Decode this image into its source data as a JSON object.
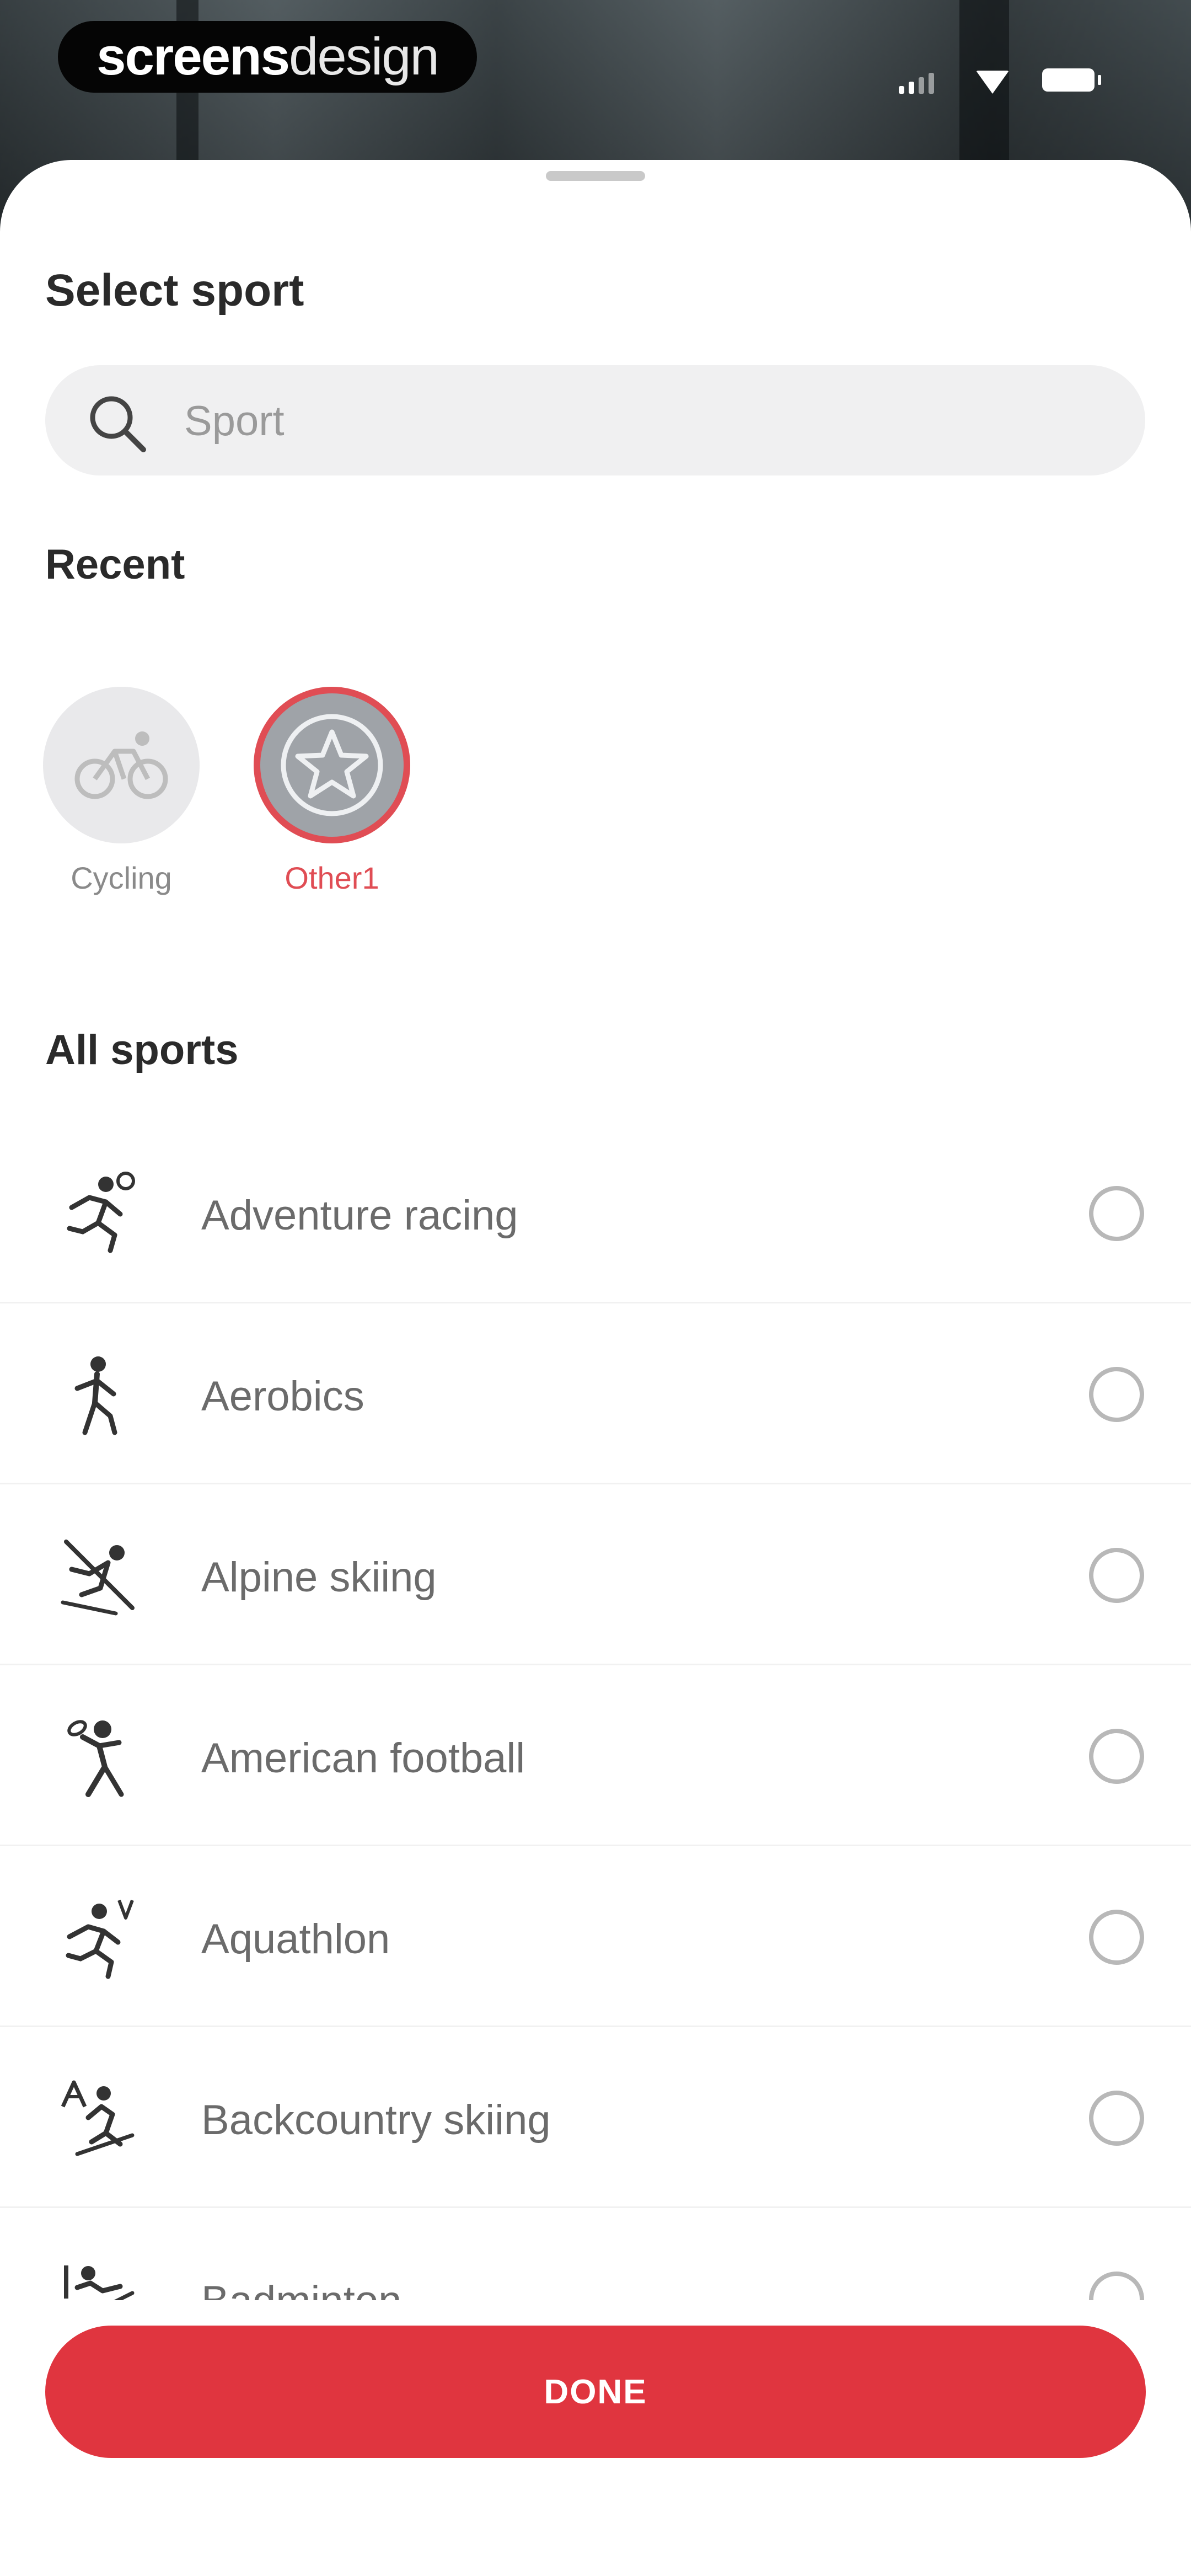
{
  "watermark": {
    "bold": "screens",
    "light": "design"
  },
  "sheet": {
    "title": "Select sport",
    "search": {
      "placeholder": "Sport",
      "value": ""
    },
    "recent": {
      "heading": "Recent",
      "items": [
        {
          "label": "Cycling",
          "icon": "bike-icon",
          "selected": false
        },
        {
          "label": "Other1",
          "icon": "star-icon",
          "selected": true
        }
      ]
    },
    "all_sports": {
      "heading": "All sports",
      "items": [
        {
          "label": "Adventure racing",
          "icon": "runner-icon",
          "checked": false
        },
        {
          "label": "Aerobics",
          "icon": "aerobics-icon",
          "checked": false
        },
        {
          "label": "Alpine skiing",
          "icon": "skier-icon",
          "checked": false
        },
        {
          "label": "American football",
          "icon": "football-player-icon",
          "checked": false
        },
        {
          "label": "Aquathlon",
          "icon": "aquathlon-icon",
          "checked": false
        },
        {
          "label": "Backcountry skiing",
          "icon": "backcountry-ski-icon",
          "checked": false
        },
        {
          "label": "Badminton",
          "icon": "badminton-icon",
          "checked": false
        }
      ]
    },
    "done_label": "DONE"
  },
  "colors": {
    "accent": "#e0353f",
    "selected_ring": "#e04d54",
    "text": "#2a2a2a",
    "muted": "#6b6b6b"
  }
}
